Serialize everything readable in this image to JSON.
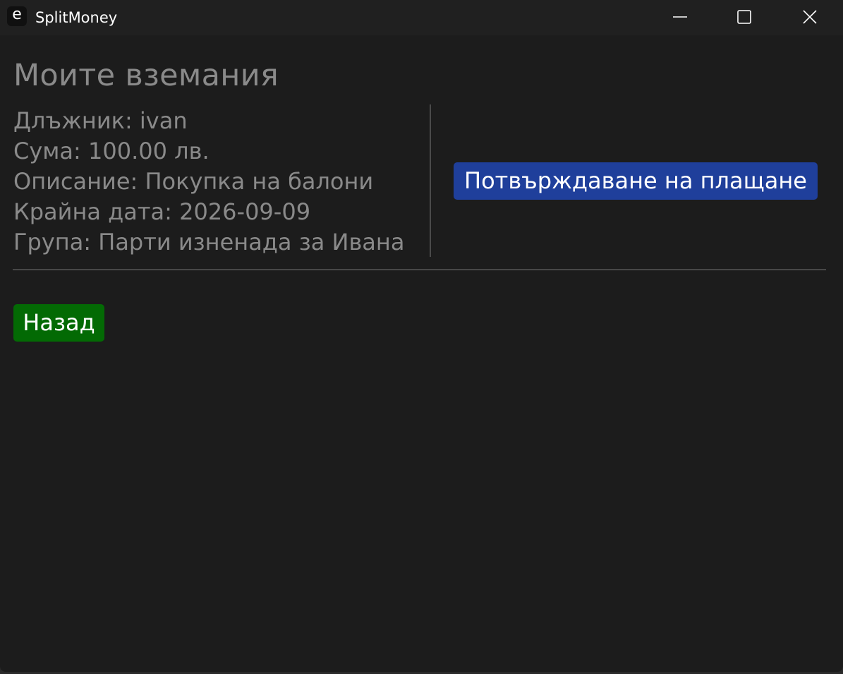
{
  "window": {
    "app_icon_glyph": "e",
    "title": "SplitMoney",
    "controls": [
      {
        "name": "minimize",
        "icon": "minimize-icon"
      },
      {
        "name": "maximize",
        "icon": "maximize-icon"
      },
      {
        "name": "close",
        "icon": "close-icon"
      }
    ]
  },
  "page": {
    "title": "Моите вземания"
  },
  "receivable": {
    "debtor": "Длъжник: ivan",
    "amount": "Сума: 100.00 лв.",
    "description": "Описание: Покупка на балони",
    "due_date": "Крайна дата: 2026-09-09",
    "group": "Група: Парти изненада за Ивана"
  },
  "actions": {
    "confirm_payment_label": "Потвърждаване на плащане",
    "back_label": "Назад"
  },
  "colors": {
    "background": "#1c1c1c",
    "titlebar": "#202020",
    "text_muted": "#8a8a8a",
    "confirm_button": "#1f3f9b",
    "back_button": "#036a04"
  }
}
